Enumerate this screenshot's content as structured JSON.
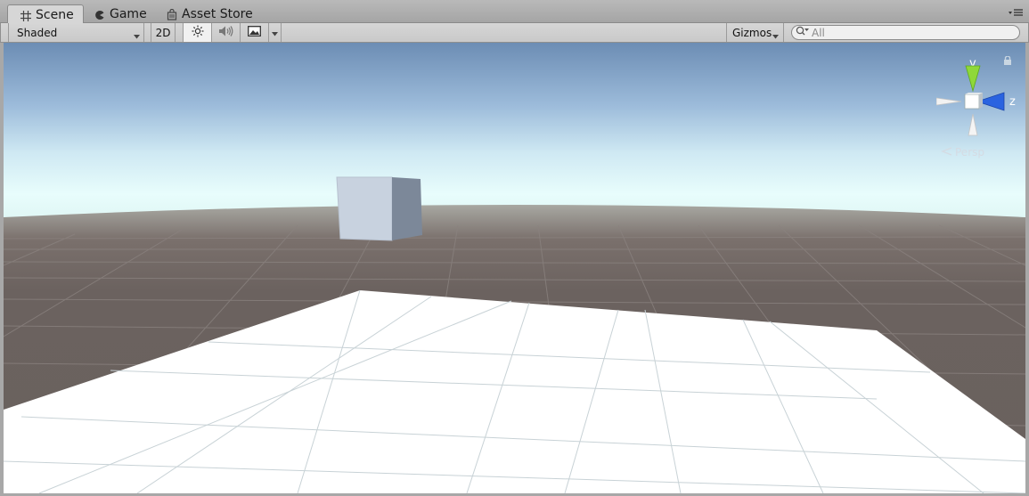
{
  "tabs": [
    {
      "label": "Scene",
      "icon": "grid-icon",
      "active": true
    },
    {
      "label": "Game",
      "icon": "pacman-icon",
      "active": false
    },
    {
      "label": "Asset Store",
      "icon": "bag-icon",
      "active": false
    }
  ],
  "toolbar": {
    "draw_mode": "Shaded",
    "mode_2d": "2D",
    "lighting_icon": "sun-icon",
    "audio_icon": "speaker-icon",
    "effects_icon": "image-icon",
    "gizmos": "Gizmos",
    "search_placeholder": "All"
  },
  "viewport": {
    "projection": "Persp",
    "axes": {
      "y": "y",
      "z": "z"
    },
    "colors": {
      "sky_top": "#6f8fb5",
      "sky_horizon": "#e6fbfb",
      "ground": "#6b625f",
      "plane": "#ffffff",
      "cube": "#c8d2df",
      "y_axis": "#8fd83a",
      "z_axis": "#2a63e0"
    }
  }
}
